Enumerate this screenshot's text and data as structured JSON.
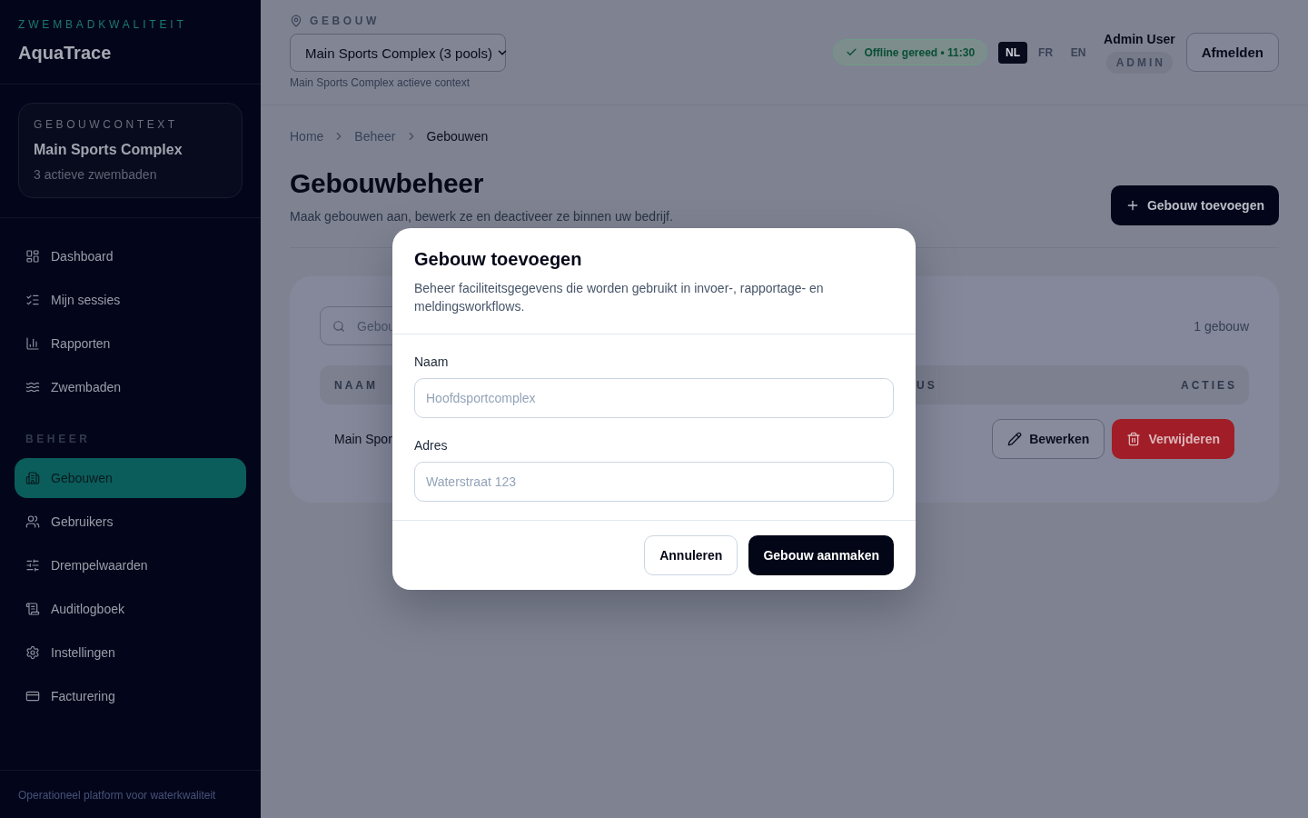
{
  "sidebar": {
    "eyebrow": "ZWEMBADKWALITEIT",
    "app_name": "AquaTrace",
    "context_card": {
      "label": "GEBOUWCONTEXT",
      "building": "Main Sports Complex",
      "subtitle": "3 actieve zwembaden"
    },
    "nav_groups": [
      {
        "items": [
          {
            "kind": "dashboard",
            "label": "Dashboard",
            "selected": false
          },
          {
            "kind": "sessions",
            "label": "Mijn sessies",
            "selected": false
          },
          {
            "kind": "reports",
            "label": "Rapporten",
            "selected": false
          },
          {
            "kind": "pools",
            "label": "Zwembaden",
            "selected": false
          }
        ]
      },
      {
        "heading": "BEHEER",
        "items": [
          {
            "kind": "buildings",
            "label": "Gebouwen",
            "selected": true
          },
          {
            "kind": "users",
            "label": "Gebruikers",
            "selected": false
          },
          {
            "kind": "thresholds",
            "label": "Drempelwaarden",
            "selected": false
          },
          {
            "kind": "audit",
            "label": "Auditlogboek",
            "selected": false
          },
          {
            "kind": "settings",
            "label": "Instellingen",
            "selected": false
          },
          {
            "kind": "billing",
            "label": "Facturering",
            "selected": false
          }
        ]
      }
    ],
    "footer": "Operationeel platform voor waterkwaliteit"
  },
  "header": {
    "building_picker": {
      "label": "GEBOUW",
      "value": "Main Sports Complex (3 pools)",
      "hint": "Main Sports Complex actieve context"
    },
    "sync_status": "Offline gereed • 11:30",
    "languages": [
      {
        "label": "NL",
        "selected": true
      },
      {
        "label": "FR",
        "selected": false
      },
      {
        "label": "EN",
        "selected": false
      }
    ],
    "user": {
      "name": "Admin User",
      "role": "ADMIN"
    },
    "logout_button": "Afmelden"
  },
  "breadcrumb": [
    {
      "label": "Home",
      "current": false
    },
    {
      "label": "Beheer",
      "current": false
    },
    {
      "label": "Gebouwen",
      "current": true
    }
  ],
  "page": {
    "title": "Gebouwbeheer",
    "subtitle": "Maak gebouwen aan, bewerk ze en deactiveer ze binnen uw bedrijf.",
    "add_button": "Gebouw toevoegen"
  },
  "buildings_table": {
    "search": {
      "placeholder": "Gebou"
    },
    "count": "1 gebouw",
    "columns": [
      "NAAM",
      "US",
      "ACTIES"
    ],
    "rows": [
      {
        "cells": [
          "Main Spor"
        ],
        "actions": [
          {
            "kind": "edit",
            "label": "Bewerken"
          },
          {
            "kind": "delete",
            "label": "Verwijderen"
          }
        ]
      }
    ]
  },
  "dialog": {
    "title": "Gebouw toevoegen",
    "description": "Beheer faciliteitsgegevens die worden gebruikt in invoer-, rapportage- en meldingsworkflows.",
    "fields": [
      {
        "label": "Naam",
        "placeholder": "Hoofdsportcomplex"
      },
      {
        "label": "Adres",
        "placeholder": "Waterstraat 123"
      }
    ],
    "buttons": [
      {
        "kind": "secondary",
        "label": "Annuleren"
      },
      {
        "kind": "primary",
        "label": "Gebouw aanmaken"
      }
    ]
  }
}
